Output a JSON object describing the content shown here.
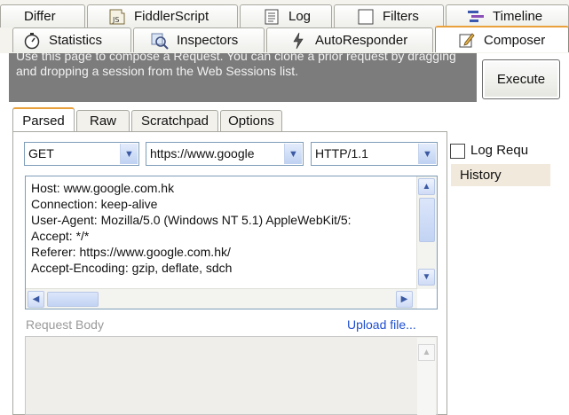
{
  "tabs_row1": [
    {
      "label": "Differ",
      "icon": "none"
    },
    {
      "label": "FiddlerScript",
      "icon": "js-script-icon"
    },
    {
      "label": "Log",
      "icon": "log-icon"
    },
    {
      "label": "Filters",
      "icon": "checkbox-icon"
    },
    {
      "label": "Timeline",
      "icon": "timeline-icon"
    }
  ],
  "tabs_row2": [
    {
      "label": "Statistics",
      "icon": "stopwatch-icon"
    },
    {
      "label": "Inspectors",
      "icon": "inspect-icon"
    },
    {
      "label": "AutoResponder",
      "icon": "lightning-icon"
    },
    {
      "label": "Composer",
      "icon": "pencil-icon",
      "active": true
    }
  ],
  "js_badge": "JS",
  "composer": {
    "info_text": "Use this page to compose a Request. You can clone a prior request by dragging and dropping a session from the Web Sessions list.",
    "execute_label": "Execute",
    "subtabs": [
      "Parsed",
      "Raw",
      "Scratchpad",
      "Options"
    ],
    "active_subtab": "Parsed",
    "method": "GET",
    "url": "https://www.google",
    "version": "HTTP/1.1",
    "headers": [
      "Host: www.google.com.hk",
      "Connection: keep-alive",
      "User-Agent: Mozilla/5.0 (Windows NT 5.1) AppleWebKit/5:",
      "Accept: */*",
      "Referer: https://www.google.com.hk/",
      "Accept-Encoding: gzip, deflate, sdch"
    ],
    "request_body_label": "Request Body",
    "upload_label": "Upload file...",
    "log_requests_label": "Log Requ",
    "log_requests_checked": false,
    "history_label": "History"
  },
  "colors": {
    "active_tab_accent": "#e9a13b",
    "info_bg": "#7c7c7c",
    "link": "#1f4fd0"
  }
}
